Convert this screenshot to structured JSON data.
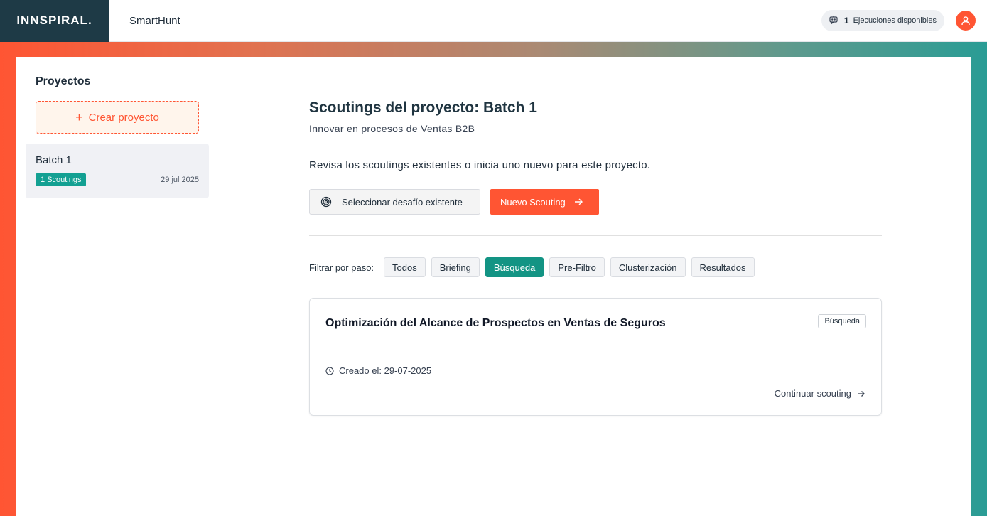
{
  "header": {
    "logo": "INNSPIRAL.",
    "app_name": "SmartHunt",
    "executions_count": "1",
    "executions_label": "Ejecuciones disponibles"
  },
  "sidebar": {
    "title": "Proyectos",
    "create_label": "Crear proyecto",
    "projects": [
      {
        "name": "Batch 1",
        "badge": "1 Scoutings",
        "date": "29 jul 2025"
      }
    ]
  },
  "main": {
    "title": "Scoutings del proyecto: Batch 1",
    "subtitle": "Innovar en procesos de Ventas B2B",
    "description": "Revisa los scoutings existentes o inicia uno nuevo para este proyecto.",
    "select_challenge_label": "Seleccionar desafío existente",
    "new_scouting_label": "Nuevo Scouting",
    "filter_label": "Filtrar por paso:",
    "filters": [
      "Todos",
      "Briefing",
      "Búsqueda",
      "Pre-Filtro",
      "Clusterización",
      "Resultados"
    ],
    "active_filter": "Búsqueda",
    "scoutings": [
      {
        "title": "Optimización del Alcance de Prospectos en Ventas de Seguros",
        "stage": "Búsqueda",
        "created": "Creado el: 29-07-2025",
        "continue_label": "Continuar scouting"
      }
    ]
  },
  "colors": {
    "accent": "#ff5533",
    "teal": "#139484",
    "logo_bg": "#1e3a46"
  }
}
